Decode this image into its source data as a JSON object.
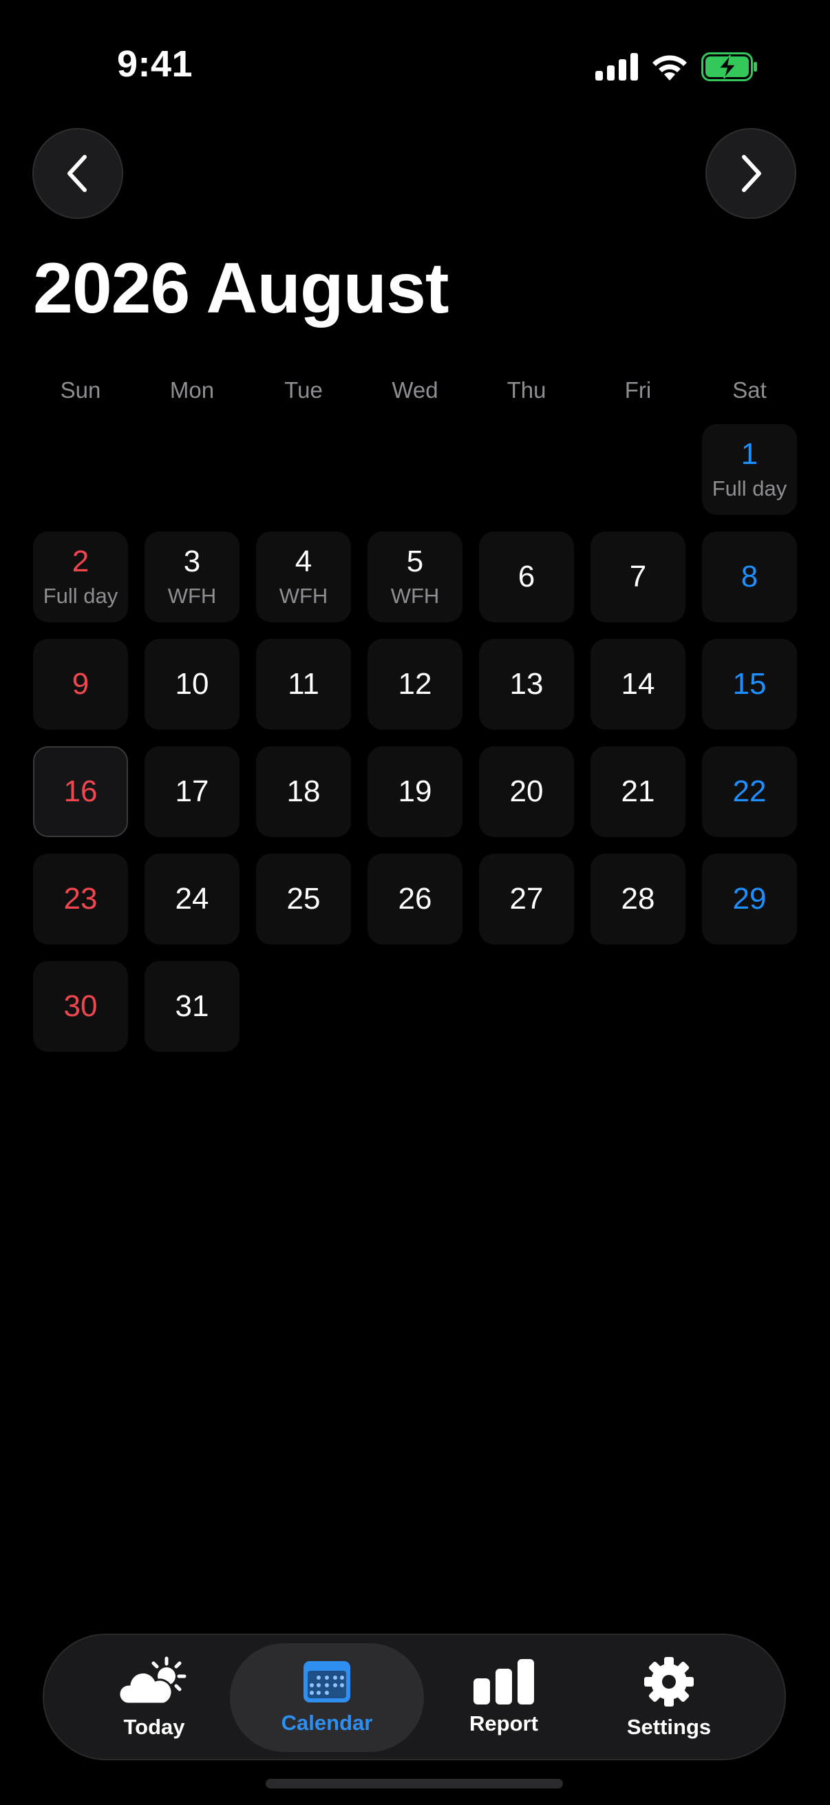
{
  "status": {
    "time": "9:41",
    "battery_color": "#34c759"
  },
  "header": {
    "prev_icon": "chevron-left-icon",
    "next_icon": "chevron-right-icon",
    "title": "2026 August"
  },
  "calendar": {
    "weekdays": [
      "Sun",
      "Mon",
      "Tue",
      "Wed",
      "Thu",
      "Fri",
      "Sat"
    ],
    "leading_blanks": 6,
    "selected_day": "16",
    "colors": {
      "sunday": "#f0474f",
      "saturday": "#1e8fff",
      "weekday": "#ffffff",
      "note": "#8e8e93"
    },
    "days": [
      {
        "day": "1",
        "note": "Full day"
      },
      {
        "day": "2",
        "note": "Full day"
      },
      {
        "day": "3",
        "note": "WFH"
      },
      {
        "day": "4",
        "note": "WFH"
      },
      {
        "day": "5",
        "note": "WFH"
      },
      {
        "day": "6",
        "note": ""
      },
      {
        "day": "7",
        "note": ""
      },
      {
        "day": "8",
        "note": ""
      },
      {
        "day": "9",
        "note": ""
      },
      {
        "day": "10",
        "note": ""
      },
      {
        "day": "11",
        "note": ""
      },
      {
        "day": "12",
        "note": ""
      },
      {
        "day": "13",
        "note": ""
      },
      {
        "day": "14",
        "note": ""
      },
      {
        "day": "15",
        "note": ""
      },
      {
        "day": "16",
        "note": ""
      },
      {
        "day": "17",
        "note": ""
      },
      {
        "day": "18",
        "note": ""
      },
      {
        "day": "19",
        "note": ""
      },
      {
        "day": "20",
        "note": ""
      },
      {
        "day": "21",
        "note": ""
      },
      {
        "day": "22",
        "note": ""
      },
      {
        "day": "23",
        "note": ""
      },
      {
        "day": "24",
        "note": ""
      },
      {
        "day": "25",
        "note": ""
      },
      {
        "day": "26",
        "note": ""
      },
      {
        "day": "27",
        "note": ""
      },
      {
        "day": "28",
        "note": ""
      },
      {
        "day": "29",
        "note": ""
      },
      {
        "day": "30",
        "note": ""
      },
      {
        "day": "31",
        "note": ""
      }
    ]
  },
  "tabbar": {
    "active_color": "#2f8ff0",
    "tabs": [
      {
        "label": "Today",
        "icon": "weather-icon"
      },
      {
        "label": "Calendar",
        "icon": "calendar-icon",
        "active": true
      },
      {
        "label": "Report",
        "icon": "bar-chart-icon"
      },
      {
        "label": "Settings",
        "icon": "gear-icon"
      }
    ]
  }
}
